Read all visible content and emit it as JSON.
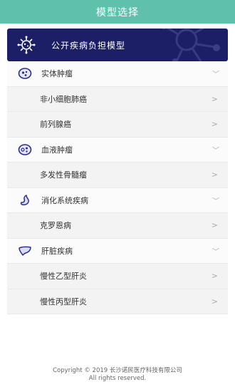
{
  "header": {
    "title": "模型选择"
  },
  "banner": {
    "label": "公开疾病负担模型",
    "icon": "virus-icon"
  },
  "categories": [
    {
      "label": "实体肿瘤",
      "icon": "cell-icon",
      "items": [
        "非小细胞肺癌",
        "前列腺癌"
      ]
    },
    {
      "label": "血液肿瘤",
      "icon": "blood-cell-icon",
      "items": [
        "多发性骨髓瘤"
      ]
    },
    {
      "label": "消化系统疾病",
      "icon": "stomach-icon",
      "items": [
        "克罗恩病"
      ]
    },
    {
      "label": "肝脏疾病",
      "icon": "liver-icon",
      "items": [
        "慢性乙型肝炎",
        "慢性丙型肝炎"
      ]
    }
  ],
  "footer": {
    "copyright": "Copyright © 2019 长沙诺民医疗科技有限公司",
    "rights": "All rights reserved."
  },
  "colors": {
    "header": "#5fc0ab",
    "banner": "#1c1f66",
    "icon": "#2b2f8a"
  }
}
